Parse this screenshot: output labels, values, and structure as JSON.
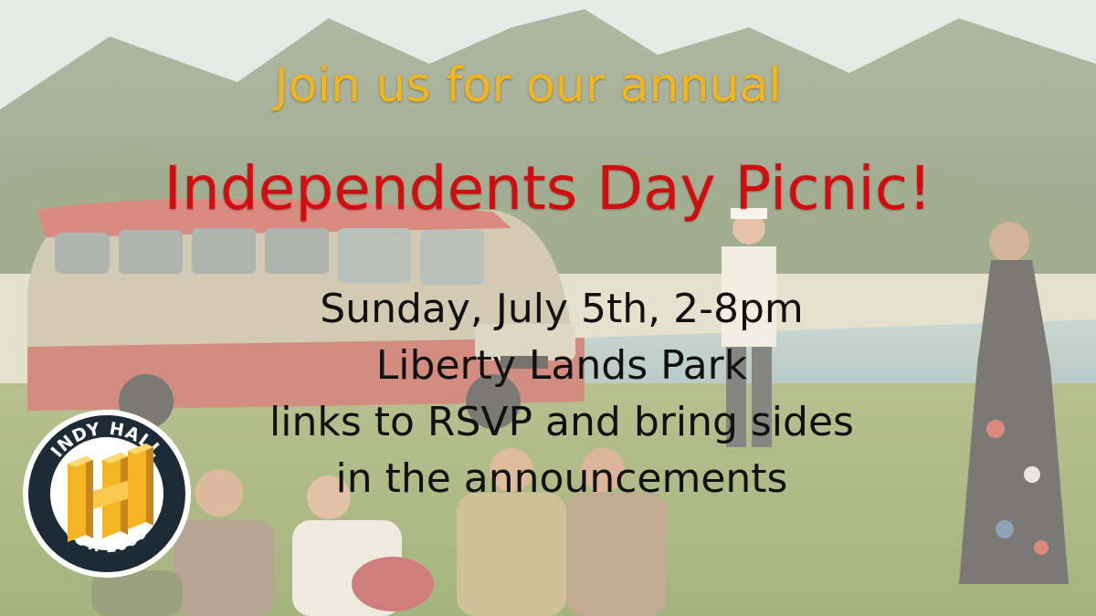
{
  "headline": {
    "intro": "Join us for our annual",
    "title": "Independents Day Picnic!"
  },
  "details": [
    "Sunday, July 5th, 2-8pm",
    "Liberty Lands Park",
    "links to RSVP and bring sides",
    "in the announcements"
  ],
  "logo": {
    "top_text": "INDY HALL",
    "bottom_text": "EST. 2006",
    "monogram": "IH"
  },
  "colors": {
    "intro_text": "#f2b51c",
    "title_text": "#d20d10",
    "details_text": "#111111",
    "logo_ring": "#1d2b36",
    "logo_gold": "#f4b423"
  }
}
